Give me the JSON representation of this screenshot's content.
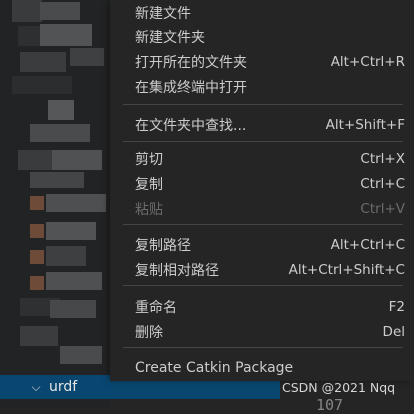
{
  "context_menu": {
    "groups": [
      [
        {
          "label": "新建文件",
          "shortcut": "",
          "disabled": false
        },
        {
          "label": "新建文件夹",
          "shortcut": "",
          "disabled": false
        },
        {
          "label": "打开所在的文件夹",
          "shortcut": "Alt+Ctrl+R",
          "disabled": false
        },
        {
          "label": "在集成终端中打开",
          "shortcut": "",
          "disabled": false
        }
      ],
      [
        {
          "label": "在文件夹中查找...",
          "shortcut": "Alt+Shift+F",
          "disabled": false
        }
      ],
      [
        {
          "label": "剪切",
          "shortcut": "Ctrl+X",
          "disabled": false
        },
        {
          "label": "复制",
          "shortcut": "Ctrl+C",
          "disabled": false
        },
        {
          "label": "粘贴",
          "shortcut": "Ctrl+V",
          "disabled": true
        }
      ],
      [
        {
          "label": "复制路径",
          "shortcut": "Alt+Ctrl+C",
          "disabled": false
        },
        {
          "label": "复制相对路径",
          "shortcut": "Alt+Ctrl+Shift+C",
          "disabled": false
        }
      ],
      [
        {
          "label": "重命名",
          "shortcut": "F2",
          "disabled": false
        },
        {
          "label": "删除",
          "shortcut": "Del",
          "disabled": false
        }
      ],
      [
        {
          "label": "Create Catkin Package",
          "shortcut": "",
          "disabled": false
        }
      ]
    ]
  },
  "explorer": {
    "selected_folder": "urdf",
    "chevron_icon": "chevron-down-icon"
  },
  "watermark": "CSDN @2021 Nqq",
  "editor_line_number": "107",
  "colors": {
    "menu_bg": "#252526",
    "text": "#cccccc",
    "disabled_text": "#6b6b6b",
    "separator": "#454545",
    "selection": "#094771"
  }
}
